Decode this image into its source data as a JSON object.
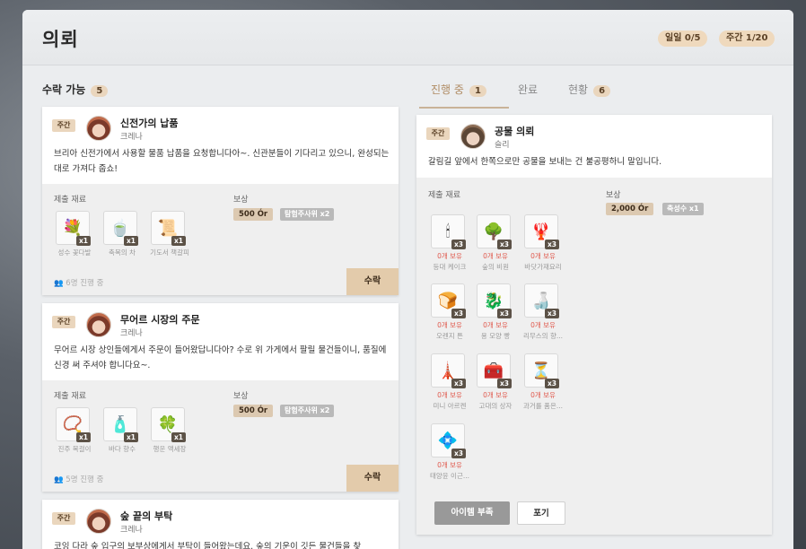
{
  "window": {
    "title": "의뢰"
  },
  "stats": {
    "daily": "일일 0/5",
    "weekly": "주간 1/20"
  },
  "available": {
    "label": "수락 가능",
    "count": "5"
  },
  "tabs": [
    {
      "label": "진행 중",
      "count": "1"
    },
    {
      "label": "완료",
      "count": ""
    },
    {
      "label": "현황",
      "count": "6"
    }
  ],
  "labels": {
    "materials": "제출 재료",
    "reward": "보상",
    "accept": "수락"
  },
  "quests": [
    {
      "badge": "주간",
      "title": "신전가의 납품",
      "giver": "크레나",
      "desc": "브리아 신전가에서 사용할 물품 납품을 요청합니다아~. 신관분들이 기다리고 있으니, 완성되는 대로 가져다 줍쇼!",
      "items": [
        {
          "name": "성수 꽃다발",
          "qty": "x1",
          "icon": "bouquet-icon",
          "glyph": "💐"
        },
        {
          "name": "축복의 차",
          "qty": "x1",
          "icon": "tea-icon",
          "glyph": "🍵"
        },
        {
          "name": "기도서 책갈피",
          "qty": "x1",
          "icon": "bookmark-icon",
          "glyph": "📜"
        }
      ],
      "reward_or": "500 Ór",
      "reward_tag": "탐험주사위 x2",
      "progress": "6명 진행 중"
    },
    {
      "badge": "주간",
      "title": "무어르 시장의 주문",
      "giver": "크레나",
      "desc": "무어르 시장 상인들에게서 주문이 들어왔답니다아? 수로 위 가게에서 팔릴 물건들이니, 품질에 신경 써 주셔야 합니다요~.",
      "items": [
        {
          "name": "진주 목걸이",
          "qty": "x1",
          "icon": "necklace-icon",
          "glyph": "📿"
        },
        {
          "name": "바다 향수",
          "qty": "x1",
          "icon": "perfume-icon",
          "glyph": "🧴"
        },
        {
          "name": "행운 액세장",
          "qty": "x1",
          "icon": "charm-icon",
          "glyph": "🍀"
        }
      ],
      "reward_or": "500 Ór",
      "reward_tag": "탐험주사위 x2",
      "progress": "5명 진행 중"
    },
    {
      "badge": "주간",
      "title": "숲 끝의 부탁",
      "giver": "크레나",
      "desc": "코잉 다라 숲 입구의 보부상에게서 부탁이 들어왔는데요. 숲의 기운이 깃든 물건들을 찾"
    }
  ],
  "active": {
    "badge": "주간",
    "title": "공물 의뢰",
    "giver": "슬리",
    "desc": "갈림길 앞에서 한쪽으로만 공물을 보내는 건 불공평하니 말입니다.",
    "reward_or": "2,000 Ór",
    "reward_tag": "축성수 x1",
    "items": [
      {
        "name": "등대 케이크",
        "owned": "0개 보유",
        "qty": "x3",
        "icon": "cake-icon",
        "glyph": "🕯"
      },
      {
        "name": "숲의 비원",
        "owned": "0개 보유",
        "qty": "x3",
        "icon": "bonsai-icon",
        "glyph": "🌳"
      },
      {
        "name": "바닷가재요리",
        "owned": "0개 보유",
        "qty": "x3",
        "icon": "lobster-icon",
        "glyph": "🦞"
      },
      {
        "name": "오렌지 튼",
        "owned": "0개 보유",
        "qty": "x3",
        "icon": "bread-icon",
        "glyph": "🍞"
      },
      {
        "name": "용 모양 빵",
        "owned": "0개 보유",
        "qty": "x3",
        "icon": "dragon-icon",
        "glyph": "🐉"
      },
      {
        "name": "리무스의 향...",
        "owned": "0개 보유",
        "qty": "x3",
        "icon": "bottle-icon",
        "glyph": "🍶"
      },
      {
        "name": "미니 아르켄",
        "owned": "0개 보유",
        "qty": "x3",
        "icon": "tower-icon",
        "glyph": "🗼"
      },
      {
        "name": "고대의 상자",
        "owned": "0개 보유",
        "qty": "x3",
        "icon": "chest-icon",
        "glyph": "🧰"
      },
      {
        "name": "과거를 품은...",
        "owned": "0개 보유",
        "qty": "x3",
        "icon": "hourglass-icon",
        "glyph": "⏳"
      },
      {
        "name": "태양윤 이근...",
        "owned": "0개 보유",
        "qty": "x3",
        "icon": "gem-icon",
        "glyph": "💠"
      }
    ],
    "btn_insufficient": "아이템 부족",
    "btn_giveup": "포기"
  }
}
